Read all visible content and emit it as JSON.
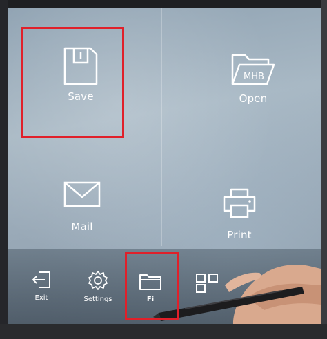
{
  "tiles": {
    "save": {
      "label": "Save",
      "icon": "floppy-disk-icon"
    },
    "open": {
      "label": "Open",
      "icon": "folder-icon",
      "folder_text": "MHB"
    },
    "mail": {
      "label": "Mail",
      "icon": "envelope-icon"
    },
    "print": {
      "label": "Print",
      "icon": "printer-icon"
    }
  },
  "taskbar": {
    "exit": {
      "label": "Exit",
      "icon": "exit-icon"
    },
    "settings": {
      "label": "Settings",
      "icon": "gear-icon"
    },
    "files": {
      "label": "Fi",
      "icon": "folder-icon"
    },
    "apps": {
      "icon": "grid-icon"
    }
  },
  "highlight_color": "#e0202a"
}
